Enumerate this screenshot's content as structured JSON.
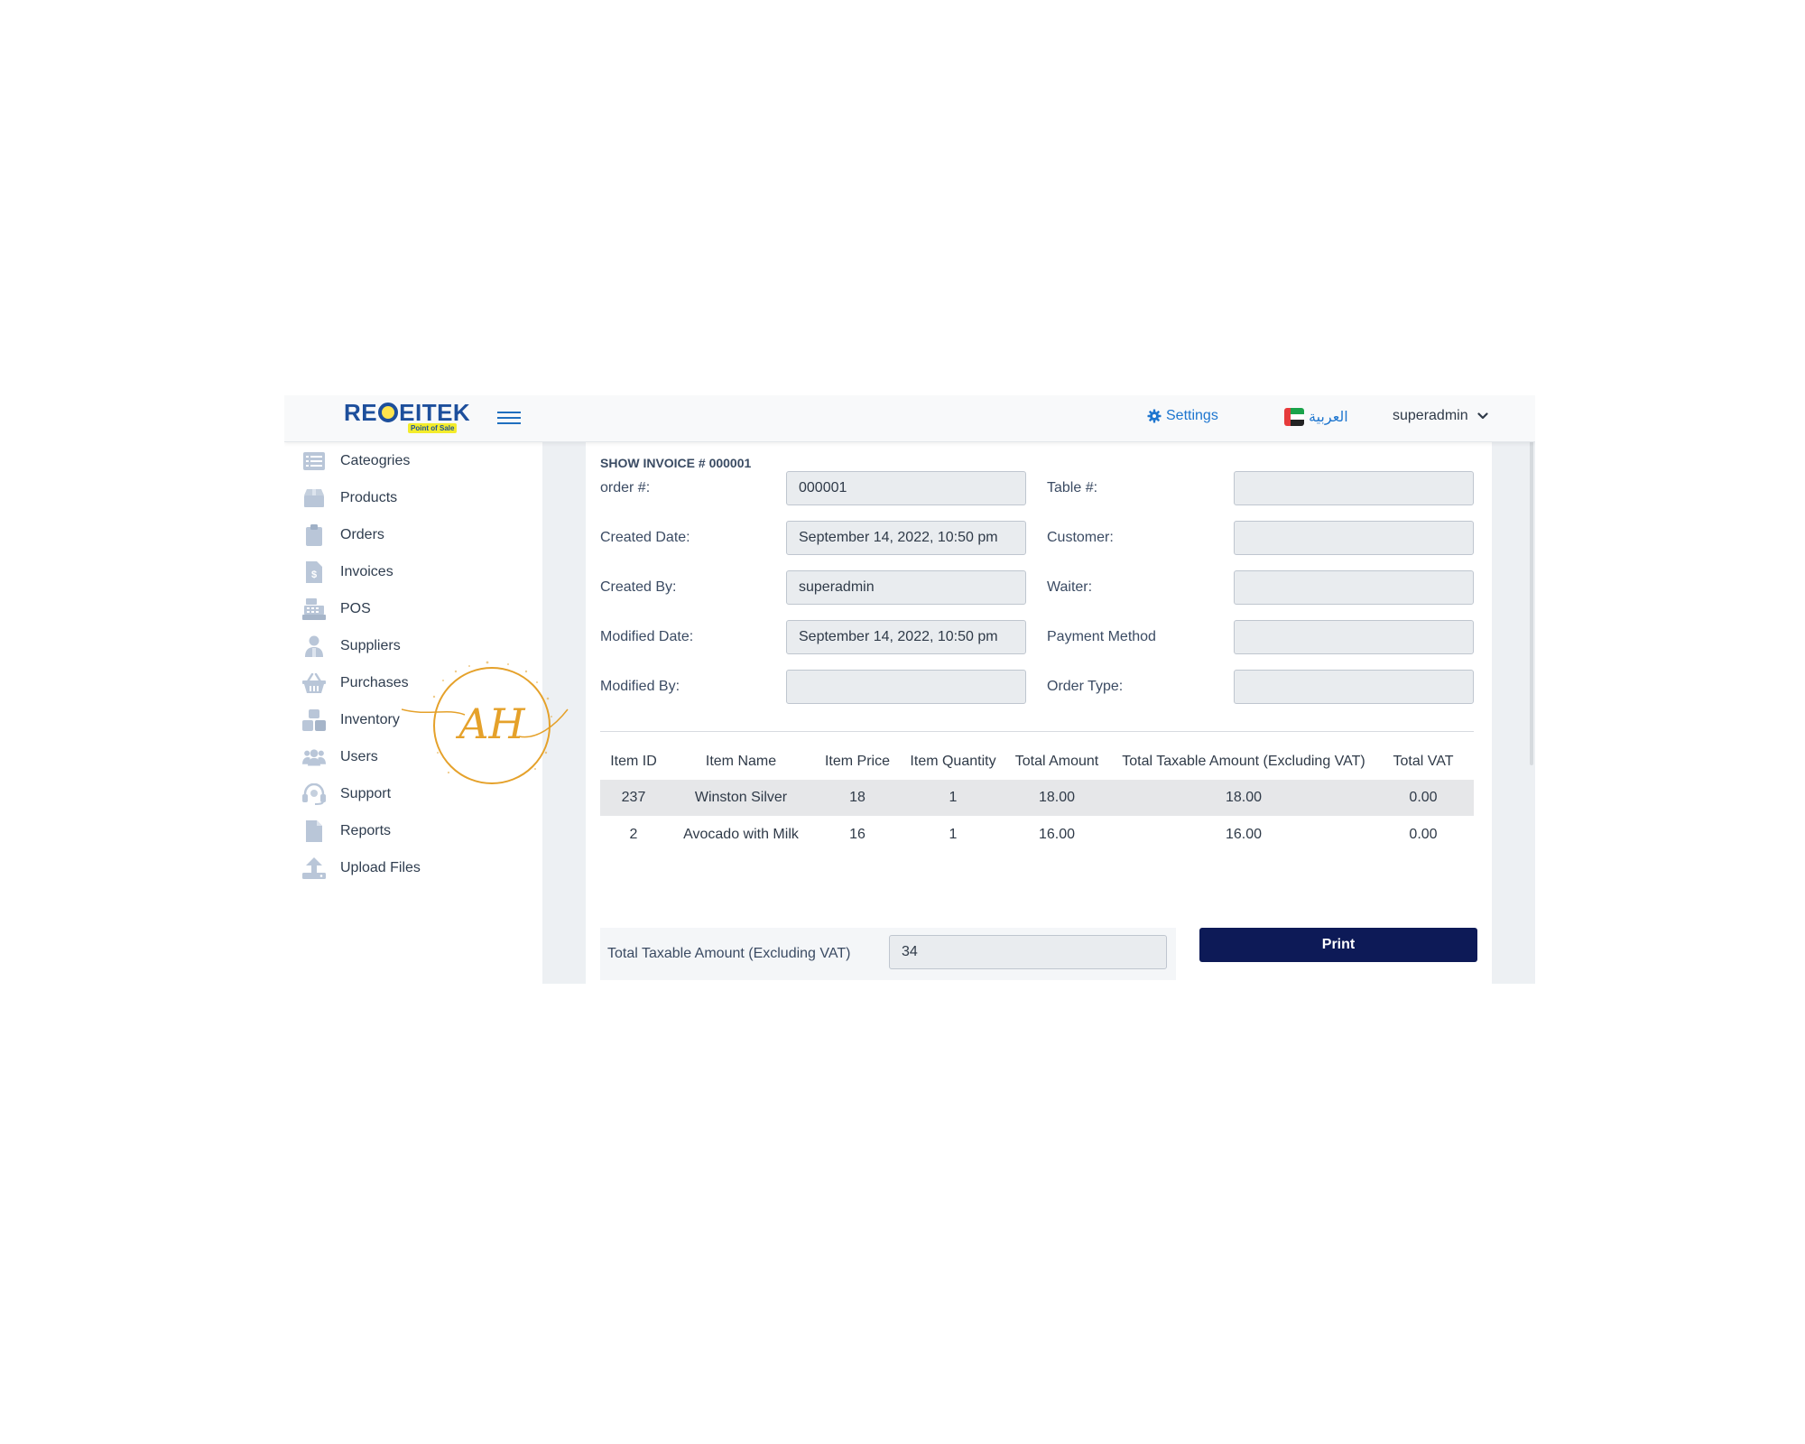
{
  "brand": {
    "logo_text": "RECEITEK",
    "tagline": "Point of Sale"
  },
  "header": {
    "settings_label": "Settings",
    "language_label": "العربية",
    "user_label": "superadmin"
  },
  "sidebar": {
    "items": [
      {
        "label": "Cateogries",
        "icon": "list-icon"
      },
      {
        "label": "Products",
        "icon": "box-icon"
      },
      {
        "label": "Orders",
        "icon": "clipboard-icon"
      },
      {
        "label": "Invoices",
        "icon": "invoice-icon"
      },
      {
        "label": "POS",
        "icon": "cash-register-icon"
      },
      {
        "label": "Suppliers",
        "icon": "supplier-icon"
      },
      {
        "label": "Purchases",
        "icon": "basket-icon"
      },
      {
        "label": "Inventory",
        "icon": "boxes-icon"
      },
      {
        "label": "Users",
        "icon": "users-icon"
      },
      {
        "label": "Support",
        "icon": "headset-icon"
      },
      {
        "label": "Reports",
        "icon": "file-icon"
      },
      {
        "label": "Upload Files",
        "icon": "upload-icon"
      }
    ]
  },
  "invoice": {
    "title": "SHOW INVOICE # 000001",
    "fields": {
      "order_no": {
        "label": "order #:",
        "value": "000001"
      },
      "created_date": {
        "label": "Created Date:",
        "value": "September 14, 2022, 10:50 pm"
      },
      "created_by": {
        "label": "Created By:",
        "value": "superadmin"
      },
      "modified_date": {
        "label": "Modified Date:",
        "value": "September 14, 2022, 10:50 pm"
      },
      "modified_by": {
        "label": "Modified By:",
        "value": ""
      },
      "table_no": {
        "label": "Table #:",
        "value": ""
      },
      "customer": {
        "label": "Customer:",
        "value": ""
      },
      "waiter": {
        "label": "Waiter:",
        "value": ""
      },
      "payment_method": {
        "label": "Payment Method",
        "value": ""
      },
      "order_type": {
        "label": "Order Type:",
        "value": ""
      }
    }
  },
  "items_table": {
    "columns": [
      "Item ID",
      "Item Name",
      "Item Price",
      "Item Quantity",
      "Total Amount",
      "Total Taxable Amount (Excluding VAT)",
      "Total VAT"
    ],
    "rows": [
      [
        "237",
        "Winston Silver",
        "18",
        "1",
        "18.00",
        "18.00",
        "0.00"
      ],
      [
        "2",
        "Avocado with Milk",
        "16",
        "1",
        "16.00",
        "16.00",
        "0.00"
      ]
    ]
  },
  "totals": {
    "label": "Total Taxable Amount (Excluding VAT)",
    "value": "34"
  },
  "print_label": "Print",
  "watermark": {
    "text": "AH"
  },
  "colors": {
    "accent": "#1e76cf",
    "print_button": "#0d1a57",
    "sidebar_icon": "#b9c6d8",
    "content_bg": "#edf0f3",
    "watermark": "#e5a12a"
  }
}
